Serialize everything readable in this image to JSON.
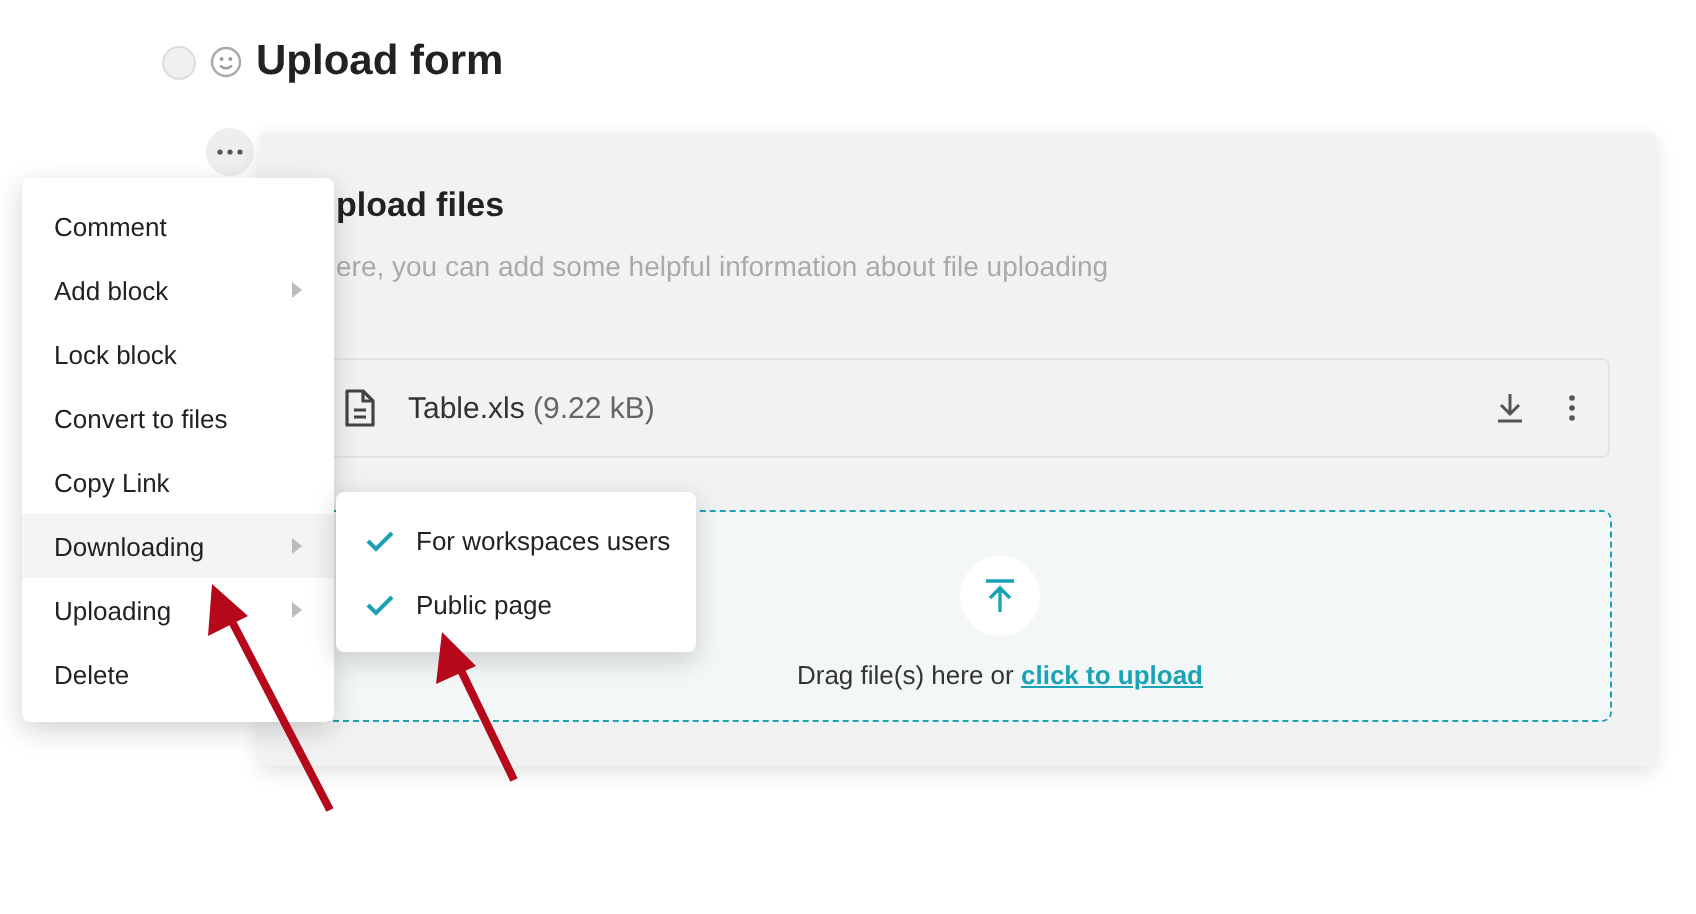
{
  "page": {
    "title": "Upload form"
  },
  "block": {
    "heading": "pload files",
    "description": "ere, you can add some helpful information about file uploading",
    "file": {
      "name": "Table.xls",
      "size": "(9.22 kB)"
    },
    "dropzone": {
      "text": "Drag file(s) here or",
      "link": "click to upload"
    }
  },
  "menu": [
    {
      "label": "Comment",
      "submenu": false,
      "selected": false
    },
    {
      "label": "Add block",
      "submenu": true,
      "selected": false
    },
    {
      "label": "Lock block",
      "submenu": false,
      "selected": false
    },
    {
      "label": "Convert to files",
      "submenu": false,
      "selected": false
    },
    {
      "label": "Copy Link",
      "submenu": false,
      "selected": false
    },
    {
      "label": "Downloading",
      "submenu": true,
      "selected": true
    },
    {
      "label": "Uploading",
      "submenu": true,
      "selected": false
    },
    {
      "label": "Delete",
      "submenu": false,
      "selected": false
    }
  ],
  "submenu": [
    {
      "label": "For workspaces users",
      "checked": true
    },
    {
      "label": "Public page",
      "checked": true
    }
  ]
}
